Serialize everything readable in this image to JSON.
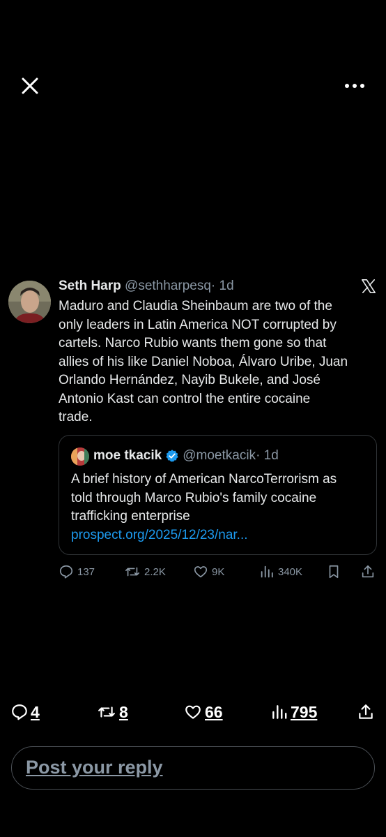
{
  "top_bar": {
    "close_icon": "close-icon",
    "more_icon": "more-horizontal-icon"
  },
  "tweet": {
    "author_name": "Seth Harp",
    "handle": "@sethharpesq",
    "time": "· 1d",
    "text_lines": [
      "Maduro and Claudia Sheinbaum are two of the",
      "only leaders in Latin America NOT corrupted by",
      "cartels. Narco Rubio wants them gone so that",
      "allies of his like Daniel Noboa, Álvaro Uribe, Juan",
      "Orlando Hernández, Nayib Bukele, and José",
      "Antonio Kast can control the entire cocaine",
      "trade."
    ],
    "quoted": {
      "author_name": "moe tkacik",
      "handle": "@moetkacik",
      "time": "· 1d",
      "text_lines": [
        "A brief history of American NarcoTerrorism as",
        "told through Marco Rubio's family cocaine",
        "trafficking enterprise"
      ],
      "link": "prospect.org/2025/12/23/nar..."
    },
    "stats": {
      "replies": "137",
      "reposts": "2.2K",
      "likes": "9K",
      "views": "340K"
    }
  },
  "bottom_actions": {
    "replies": "4",
    "reposts": "8",
    "likes": "66",
    "views": "795"
  },
  "reply_box": {
    "placeholder": "Post your reply"
  },
  "colors": {
    "background": "#000000",
    "accent": "#1d9bf0",
    "muted": "#8b98a5",
    "text": "#e7e9ea"
  }
}
